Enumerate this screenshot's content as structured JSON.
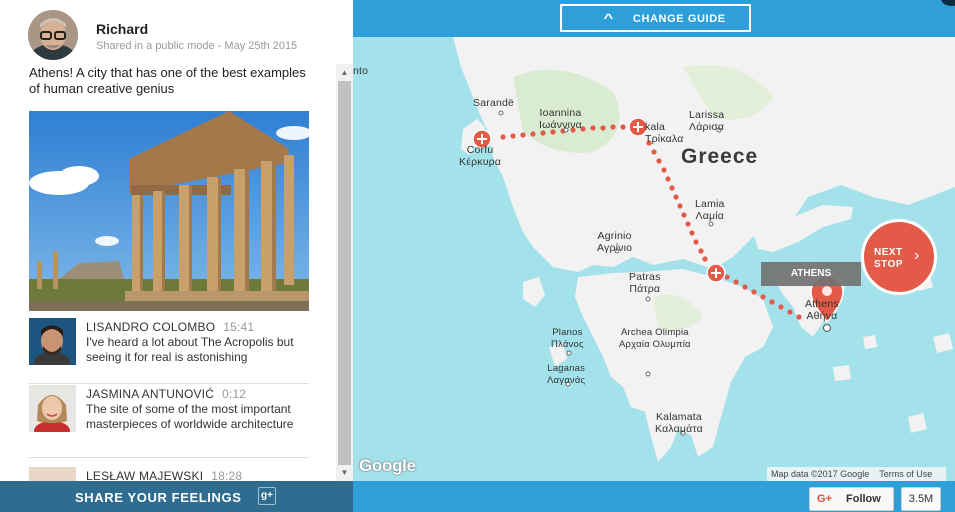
{
  "post": {
    "author_name": "Richard",
    "meta": "Shared in a public mode - May 25th 2015",
    "text": "Athens! A city that has one of the best examples of human creative genius"
  },
  "comments": [
    {
      "name": "LISANDRO COLOMBO",
      "time": "15:41",
      "text": "I've heard a lot about The Acropolis but seeing it for real is astonishing"
    },
    {
      "name": "JASMINA ANTUNOVIĆ",
      "time": "0:12",
      "text": "The site of some of the most important masterpieces of worldwide architecture"
    },
    {
      "name": "LESŁAW MAJEWSKI",
      "time": "18:28",
      "text": ""
    }
  ],
  "share": {
    "label": "SHARE YOUR FEELINGS",
    "icon": "g+"
  },
  "guide": {
    "label": "CHANGE GUIDE"
  },
  "map": {
    "country": "Greece",
    "partial_label": "nto",
    "cities": [
      {
        "name": "Sarandë"
      },
      {
        "name": "Ioannina",
        "greek": "Ιωάννινα"
      },
      {
        "name": "Larissa",
        "greek": "Λάρισα"
      },
      {
        "name": "Trikala",
        "greek": "Τρίκαλα",
        "shown_latin": "kala"
      },
      {
        "name": "Corfu",
        "greek": "Κέρκυρα"
      },
      {
        "name": "Lamia",
        "greek": "Λαμία"
      },
      {
        "name": "Agrinio",
        "greek": "Αγρίνιο"
      },
      {
        "name": "Patras",
        "greek": "Πάτρα"
      },
      {
        "name": "Planos",
        "greek": "Πλάνος"
      },
      {
        "name": "Archea Olimpia",
        "greek": "Αρχαία Ολυμπία"
      },
      {
        "name": "Laganas",
        "greek": "Λαγανάς"
      },
      {
        "name": "Athens",
        "greek": "Αθήνα"
      },
      {
        "name": "Kalamata",
        "greek": "Καλαμάτα"
      }
    ],
    "current_stop": "ATHENS",
    "next_stop_label": "NEXT STOP",
    "google": "Google",
    "map_data": "Map data ©2017 Google",
    "terms": "Terms of Use",
    "colors": {
      "route": "#e35a48",
      "water": "#a3e2ea",
      "land": "#f2f2f2",
      "header": "#2e9fd9",
      "share_bar": "#2e6d8f"
    }
  },
  "follow": {
    "label": "Follow",
    "icon": "G+",
    "count": "3.5M"
  }
}
